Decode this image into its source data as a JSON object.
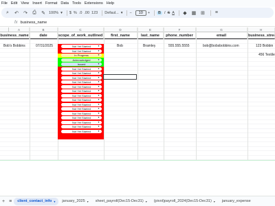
{
  "menu": [
    "File",
    "Edit",
    "View",
    "Insert",
    "Format",
    "Data",
    "Tools",
    "Extensions",
    "Help"
  ],
  "toolbar": {
    "zoom": "100%",
    "currency": "$",
    "percent": "%",
    "decimal_less": ".0",
    "decimal_more": ".00",
    "number_format": "123",
    "font": "Defaul...",
    "font_minus": "−",
    "font_size": "10",
    "font_plus": "+",
    "bold": "B",
    "italic": "I",
    "strike": "S",
    "text_color": "A"
  },
  "formula_bar": {
    "fx": "fx",
    "value": "business_name"
  },
  "columns": [
    {
      "letter": "A",
      "header": "business_name"
    },
    {
      "letter": "B",
      "header": "date"
    },
    {
      "letter": "C",
      "header": "scope_of_work_outlined"
    },
    {
      "letter": "D",
      "header": "first_name"
    },
    {
      "letter": "E",
      "header": "last_name"
    },
    {
      "letter": "F",
      "header": "phone_number"
    },
    {
      "letter": "G",
      "header": "email"
    },
    {
      "letter": "H",
      "header": "business_street"
    }
  ],
  "row2": {
    "business_name": "Bob's Bobbins",
    "date": "07/31/2025",
    "first_name": "Bob",
    "last_name": "Bramley",
    "phone_number": "555.555.5555",
    "email": "bob@bobsbobbins.com",
    "business_street": "123 Bobbin"
  },
  "row2b": {
    "business_street": "456 Textile"
  },
  "statuses": [
    "Not Yet Started",
    "Not Yet Started",
    "In Progress",
    "Acknowledged",
    "Issued",
    "Not Yet Started",
    "Not Yet Started",
    "Not Yet Started",
    "Not Yet Started",
    "Not Yet Started",
    "Not Yet Started",
    "Not Yet Started",
    "Not Yet Started",
    "Not Yet Started",
    "Not Yet Started",
    "Not Yet Started",
    "Not Yet Started",
    "Not Yet Started",
    "Not Yet Started",
    "Not Yet Started"
  ],
  "status_colors": {
    "Not Yet Started": {
      "bg": "#ffffff",
      "fg": "#202124",
      "row": "#ff0000"
    },
    "In Progress": {
      "bg": "#fff2b3",
      "fg": "#202124",
      "row": "#ffff00"
    },
    "Acknowledged": {
      "bg": "#d4f7c9",
      "fg": "#202124",
      "row": "#00ff00"
    },
    "Issued": {
      "bg": "#d3e3fd",
      "fg": "#202124",
      "row": "#00ff00"
    }
  },
  "sheet_tabs": {
    "add": "+",
    "list": "≡",
    "tabs": [
      {
        "label": "client_contact_info",
        "active": true
      },
      {
        "label": "january_2025",
        "active": false
      },
      {
        "label": "sheet_payroll(Dec15-Dec31)",
        "active": false
      },
      {
        "label": "(pivot)payroll_2024(Dec15-Dec31)",
        "active": false
      },
      {
        "label": "january_expense",
        "active": false
      }
    ]
  }
}
